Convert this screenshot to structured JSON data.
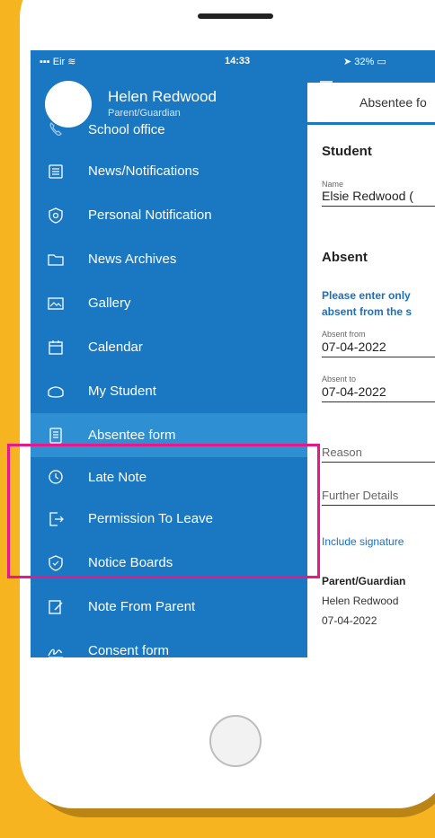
{
  "status_left": {
    "carrier": "Eir"
  },
  "status_time": "14:33",
  "panel_status": {
    "battery": "32%"
  },
  "profile": {
    "name": "Helen Redwood",
    "role": "Parent/Guardian"
  },
  "menu": [
    {
      "label": "School office",
      "icon": "phone-icon"
    },
    {
      "label": "News/Notifications",
      "icon": "newspaper-icon"
    },
    {
      "label": "Personal Notification",
      "icon": "shield-icon"
    },
    {
      "label": "News Archives",
      "icon": "folder-icon"
    },
    {
      "label": "Gallery",
      "icon": "image-icon"
    },
    {
      "label": "Calendar",
      "icon": "calendar-icon"
    },
    {
      "label": "My Student",
      "icon": "student-cap-icon"
    },
    {
      "label": "Absentee form",
      "icon": "form-icon",
      "active": true
    },
    {
      "label": "Late Note",
      "icon": "clock-icon"
    },
    {
      "label": "Permission To Leave",
      "icon": "exit-icon"
    },
    {
      "label": "Notice Boards",
      "icon": "badge-icon"
    },
    {
      "label": "Note From Parent",
      "icon": "note-pen-icon"
    },
    {
      "label": "Consent form",
      "icon": "signature-icon"
    }
  ],
  "form": {
    "tab_title": "Absentee fo",
    "student_heading": "Student",
    "name_label": "Name",
    "name_value": "Elsie Redwood (",
    "absent_heading": "Absent",
    "notice_line1": "Please enter only",
    "notice_line2": "absent from the s",
    "absent_from_label": "Absent from",
    "absent_from_value": "07-04-2022",
    "absent_to_label": "Absent to",
    "absent_to_value": "07-04-2022",
    "reason_placeholder": "Reason",
    "further_details_placeholder": "Further Details",
    "signature_link": "Include signature",
    "parent_heading": "Parent/Guardian",
    "parent_name": "Helen Redwood",
    "parent_date": "07-04-2022"
  },
  "colors": {
    "drawer": "#1a78c2",
    "active_item": "#2e8fd3",
    "highlight": "#e8188a",
    "background": "#f7b421"
  }
}
